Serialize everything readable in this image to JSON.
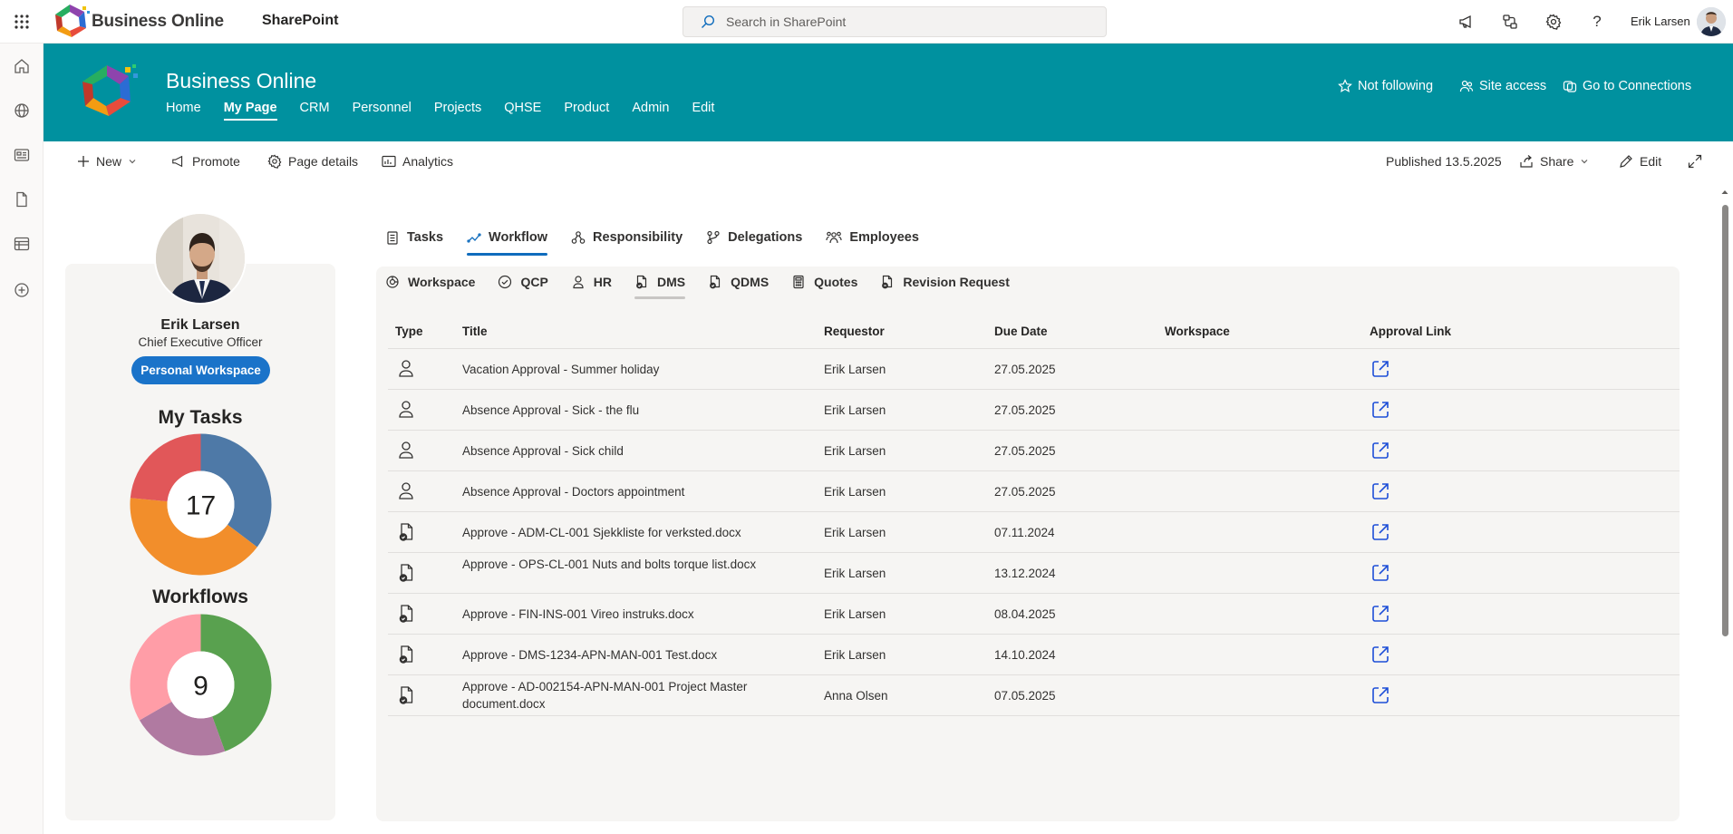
{
  "suite": {
    "brand": "Business Online",
    "app": "SharePoint",
    "search_placeholder": "Search in SharePoint",
    "user": "Erik Larsen"
  },
  "site": {
    "title": "Business Online",
    "nav": [
      "Home",
      "My Page",
      "CRM",
      "Personnel",
      "Projects",
      "QHSE",
      "Product",
      "Admin",
      "Edit"
    ],
    "active_nav": "My Page",
    "actions": {
      "follow": "Not following",
      "access": "Site access",
      "connections": "Go to Connections"
    }
  },
  "commandbar": {
    "new": "New",
    "promote": "Promote",
    "details": "Page details",
    "analytics": "Analytics",
    "published": "Published 13.5.2025",
    "share": "Share",
    "edit": "Edit"
  },
  "profile": {
    "name": "Erik Larsen",
    "role": "Chief Executive Officer",
    "workspace_button": "Personal Workspace"
  },
  "charts": {
    "tasks": {
      "title": "My Tasks",
      "total": "17",
      "colors": [
        "#4e79a7",
        "#f28e2b",
        "#e15759"
      ]
    },
    "workflows": {
      "title": "Workflows",
      "total": "9",
      "colors": [
        "#59a14f",
        "#b07aa1",
        "#ff9da7"
      ]
    }
  },
  "chart_data": [
    {
      "type": "pie",
      "title": "My Tasks",
      "center_label": "17",
      "values": [
        6,
        7,
        4
      ]
    },
    {
      "type": "pie",
      "title": "Workflows",
      "center_label": "9",
      "values": [
        4,
        2,
        3
      ]
    }
  ],
  "tabs": [
    "Tasks",
    "Workflow",
    "Responsibility",
    "Delegations",
    "Employees"
  ],
  "active_tab": "Workflow",
  "subtabs": [
    "Workspace",
    "QCP",
    "HR",
    "DMS",
    "QDMS",
    "Quotes",
    "Revision Request"
  ],
  "active_subtab": "DMS",
  "table": {
    "headers": {
      "type": "Type",
      "title": "Title",
      "requestor": "Requestor",
      "due": "Due Date",
      "workspace": "Workspace",
      "link": "Approval Link"
    },
    "rows": [
      {
        "type": "person-icon",
        "title": "Vacation Approval - Summer holiday",
        "requestor": "Erik Larsen",
        "due": "27.05.2025",
        "workspace": ""
      },
      {
        "type": "person-icon",
        "title": "Absence Approval - Sick - the flu",
        "requestor": "Erik Larsen",
        "due": "27.05.2025",
        "workspace": ""
      },
      {
        "type": "person-icon",
        "title": "Absence Approval - Sick child",
        "requestor": "Erik Larsen",
        "due": "27.05.2025",
        "workspace": ""
      },
      {
        "type": "person-icon",
        "title": "Absence Approval - Doctors appointment",
        "requestor": "Erik Larsen",
        "due": "27.05.2025",
        "workspace": ""
      },
      {
        "type": "document-check-icon",
        "title": "Approve - ADM-CL-001 Sjekkliste for verksted.docx",
        "requestor": "Erik Larsen",
        "due": "07.11.2024",
        "workspace": ""
      },
      {
        "type": "document-check-icon",
        "title": "Approve - OPS-CL-001 Nuts and bolts torque list.docx",
        "requestor": "Erik Larsen",
        "due": "13.12.2024",
        "workspace": ""
      },
      {
        "type": "document-check-icon",
        "title": "Approve - FIN-INS-001 Vireo instruks.docx",
        "requestor": "Erik Larsen",
        "due": "08.04.2025",
        "workspace": ""
      },
      {
        "type": "document-check-icon",
        "title": "Approve - DMS-1234-APN-MAN-001 Test.docx",
        "requestor": "Erik Larsen",
        "due": "14.10.2024",
        "workspace": ""
      },
      {
        "type": "document-check-icon",
        "title": "Approve - AD-002154-APN-MAN-001 Project Master document.docx",
        "requestor": "Anna Olsen",
        "due": "07.05.2025",
        "workspace": ""
      }
    ]
  }
}
